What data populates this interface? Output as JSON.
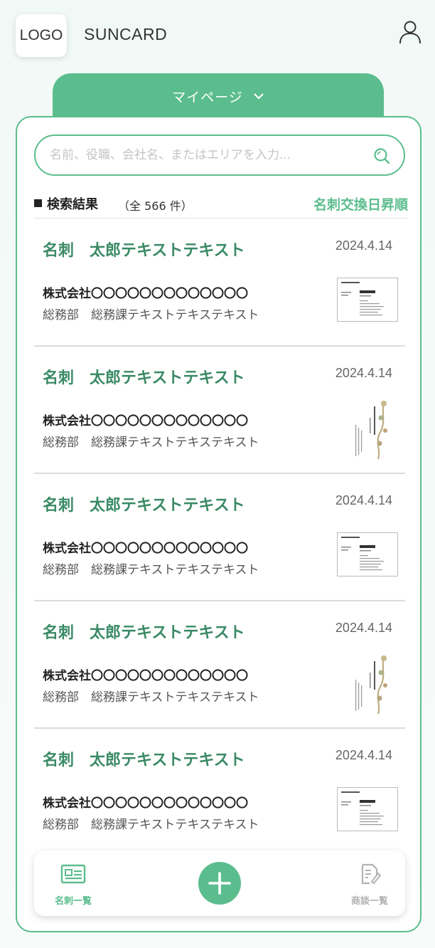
{
  "header": {
    "logo_text": "LOGO",
    "brand": "SUNCARD",
    "user_icon": "user-icon"
  },
  "menu": {
    "label": "マイページ",
    "icon": "chevron-down-icon"
  },
  "search": {
    "placeholder": "名前、役職、会社名、またはエリアを入力...",
    "value": "",
    "icon": "search-icon"
  },
  "results": {
    "title": "検索結果",
    "count_text": "（全 566 件）",
    "sort_label": "名刺交換日昇順"
  },
  "cards": [
    {
      "name": "名刺　太郎テキストテキスト",
      "date": "2024.4.14",
      "company": "株式会社〇〇〇〇〇〇〇〇〇〇〇〇〇",
      "dept": "総務部　総務課テキストテキステキスト",
      "thumbnail": "horizontal"
    },
    {
      "name": "名刺　太郎テキストテキスト",
      "date": "2024.4.14",
      "company": "株式会社〇〇〇〇〇〇〇〇〇〇〇〇〇",
      "dept": "総務部　総務課テキストテキステキスト",
      "thumbnail": "vertical"
    },
    {
      "name": "名刺　太郎テキストテキスト",
      "date": "2024.4.14",
      "company": "株式会社〇〇〇〇〇〇〇〇〇〇〇〇〇",
      "dept": "総務部　総務課テキストテキステキスト",
      "thumbnail": "horizontal"
    },
    {
      "name": "名刺　太郎テキストテキスト",
      "date": "2024.4.14",
      "company": "株式会社〇〇〇〇〇〇〇〇〇〇〇〇〇",
      "dept": "総務部　総務課テキストテキステキスト",
      "thumbnail": "vertical"
    },
    {
      "name": "名刺　太郎テキストテキスト",
      "date": "2024.4.14",
      "company": "株式会社〇〇〇〇〇〇〇〇〇〇〇〇〇",
      "dept": "総務部　総務課テキストテキステキスト",
      "thumbnail": "horizontal"
    }
  ],
  "nav": {
    "cards_label": "名刺一覧",
    "deals_label": "商談一覧",
    "cards_icon": "id-card-icon",
    "add_icon": "plus-icon",
    "deals_icon": "edit-note-icon"
  },
  "colors": {
    "accent": "#5bbd8d",
    "name_text": "#3a8a65",
    "inactive": "#b3b3b3"
  }
}
